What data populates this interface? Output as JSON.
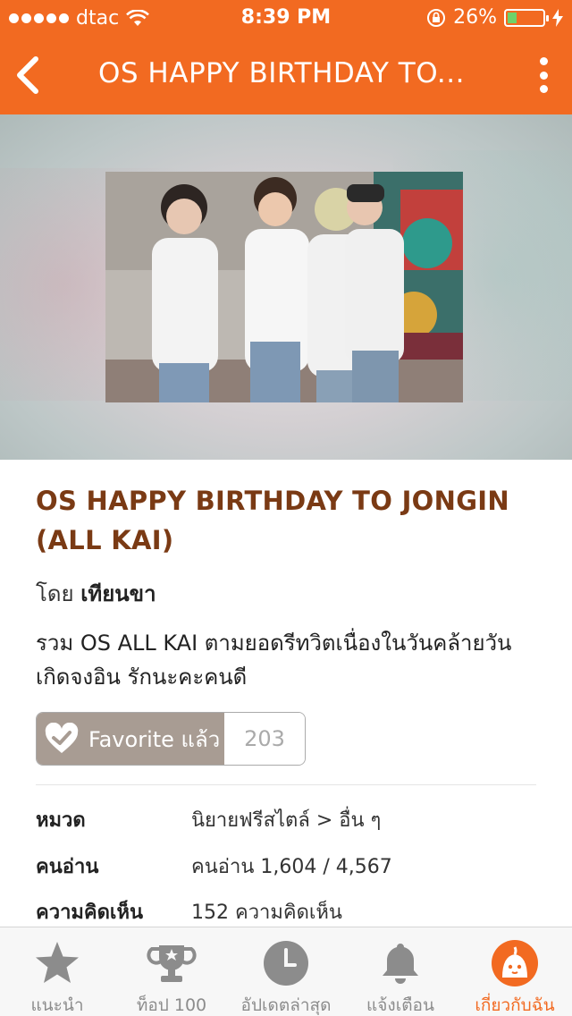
{
  "status_bar": {
    "carrier": "dtac",
    "time": "8:39 PM",
    "battery": "26%",
    "battery_level": 0.26
  },
  "nav": {
    "title": "OS HAPPY BIRTHDAY TO...",
    "back_icon": "chevron-left-icon",
    "menu_icon": "more-vertical-icon"
  },
  "story": {
    "title": "OS HAPPY BIRTHDAY TO JONGIN (ALL KAI)",
    "author_prefix": "โดย",
    "author": "เทียนขา",
    "description": "รวม OS ALL KAI ตามยอดรีทวิตเนื่องในวันคล้ายวันเกิดจงอิน รักนะคะคนดี",
    "favorite_label": "Favorite แล้ว",
    "favorite_count": "203"
  },
  "info": [
    {
      "key": "หมวด",
      "value": "นิยายฟรีสไตล์ > อื่น ๆ"
    },
    {
      "key": "คนอ่าน",
      "value": "คนอ่าน 1,604 / 4,567"
    },
    {
      "key": "ความคิดเห็น",
      "value": "152 ความคิดเห็น"
    }
  ],
  "tabs": [
    {
      "label": "แนะนำ",
      "icon": "star-icon"
    },
    {
      "label": "ท็อป 100",
      "icon": "trophy-icon"
    },
    {
      "label": "อัปเดตล่าสุด",
      "icon": "clock-icon"
    },
    {
      "label": "แจ้งเตือน",
      "icon": "bell-icon"
    },
    {
      "label": "เกี่ยวกับฉัน",
      "icon": "profile-avatar-icon",
      "active": true
    }
  ],
  "colors": {
    "brand": "#f26a21",
    "title": "#7a3a14",
    "favorite_bg": "#a89c93",
    "tab_inactive": "#8c8c8c"
  }
}
